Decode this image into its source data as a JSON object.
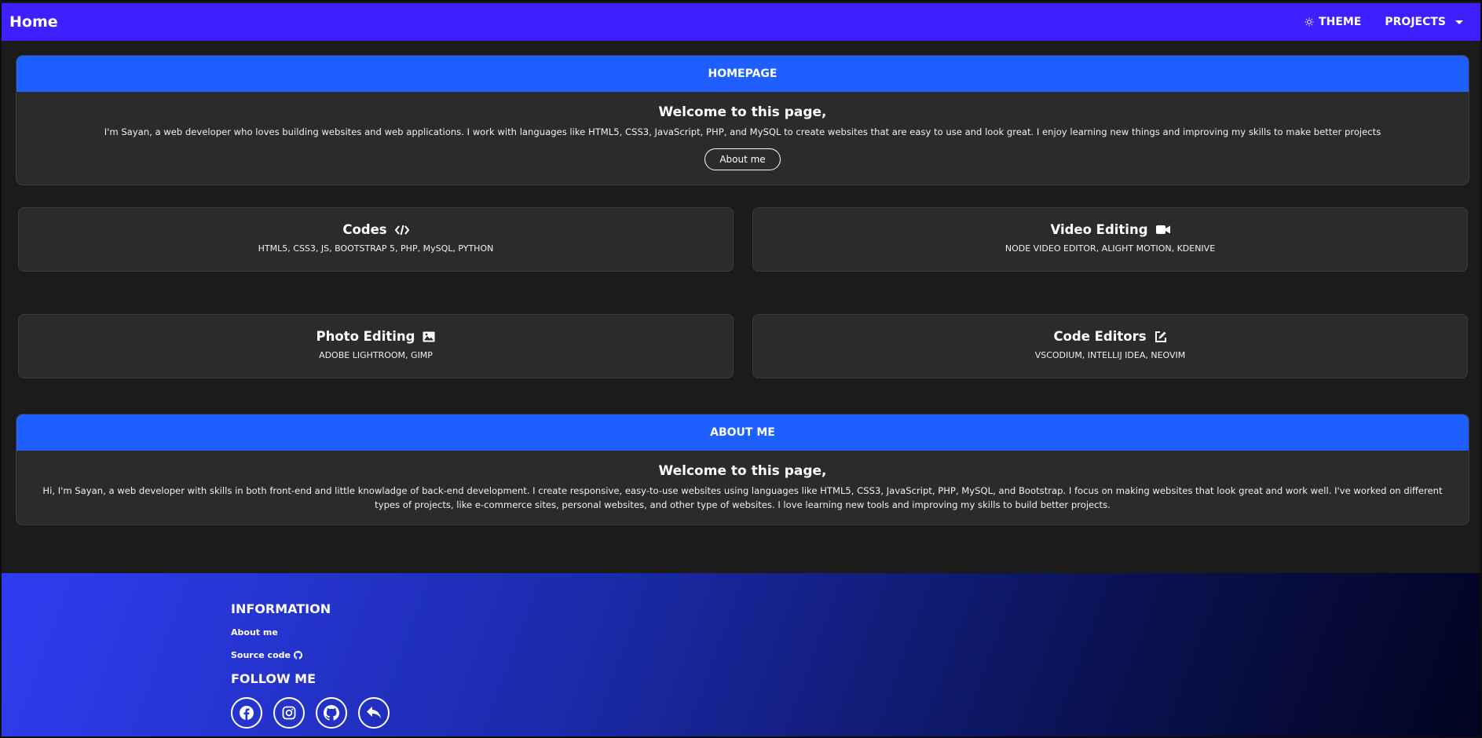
{
  "nav": {
    "brand": "Home",
    "theme_label": "THEME",
    "projects_label": "PROJECTS"
  },
  "homepage": {
    "header": "HOMEPAGE",
    "title": "Welcome to this page,",
    "text": "I'm Sayan, a web developer who loves building websites and web applications. I work with languages like HTML5, CSS3, JavaScript, PHP, and MySQL to create websites that are easy to use and look great. I enjoy learning new things and improving my skills to make better projects",
    "button": "About me"
  },
  "skills": [
    {
      "title": "Codes",
      "icon": "code-icon",
      "text": "HTML5, CSS3, JS, BOOTSTRAP 5, PHP, MySQL, PYTHON"
    },
    {
      "title": "Video Editing",
      "icon": "video-camera-icon",
      "text": "NODE VIDEO EDITOR, ALIGHT MOTION, KDENIVE"
    },
    {
      "title": "Photo Editing",
      "icon": "image-icon",
      "text": "ADOBE LIGHTROOM, GIMP"
    },
    {
      "title": "Code Editors",
      "icon": "edit-icon",
      "text": "VSCODIUM, INTELLIJ IDEA, NEOVIM"
    }
  ],
  "aboutme": {
    "header": "ABOUT ME",
    "title": "Welcome to this page,",
    "text": "Hi, I'm Sayan, a web developer with skills in both front-end and little knowladge of back-end development. I create responsive, easy-to-use websites using languages like HTML5, CSS3, JavaScript, PHP, MySQL, and Bootstrap. I focus on making websites that look great and work well. I've worked on different types of projects, like e-commerce sites, personal websites, and other type of websites. I love learning new tools and improving my skills to build better projects."
  },
  "footer": {
    "info_head": "INFORMATION",
    "about_link": "About me",
    "source_link": "Source code",
    "follow_head": "FOLLOW ME",
    "socials": [
      "facebook-icon",
      "instagram-icon",
      "github-icon",
      "reply-icon"
    ]
  },
  "colors": {
    "navbar": "#3f1fff",
    "panel_header": "#1f5fff",
    "background": "#1b1b1b",
    "card": "#2b2b2b"
  }
}
